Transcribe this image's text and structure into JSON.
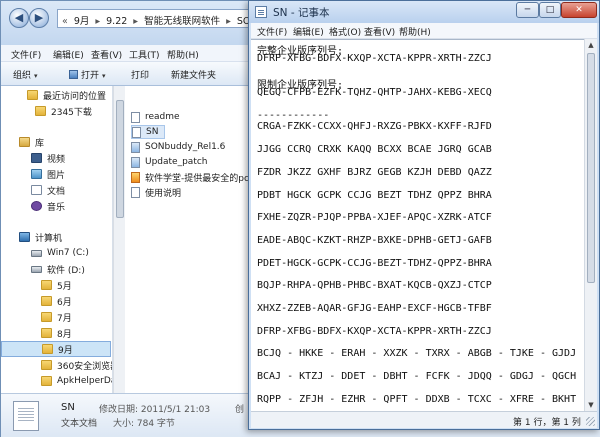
{
  "explorer": {
    "breadcrumb": [
      "«",
      "9月",
      "▸",
      "9.22",
      "▸",
      "智能无线联网软件",
      "▸",
      "SO"
    ],
    "menu": [
      "文件(F)",
      "编辑(E)",
      "查看(V)",
      "工具(T)",
      "帮助(H)"
    ],
    "toolbar": {
      "organize": "组织",
      "open": "打开",
      "print": "打印",
      "new_folder": "新建文件夹"
    },
    "nav_items": [
      {
        "label": "最近访问的位置",
        "icon": "recent-places-icon",
        "kind": "folder"
      },
      {
        "label": "2345下载",
        "icon": "folder-icon",
        "kind": "folder"
      },
      {
        "label": "库",
        "icon": "library-icon",
        "kind": "lib"
      },
      {
        "label": "视频",
        "icon": "video-icon",
        "kind": "video"
      },
      {
        "label": "图片",
        "icon": "picture-icon",
        "kind": "img"
      },
      {
        "label": "文档",
        "icon": "document-icon",
        "kind": "doc"
      },
      {
        "label": "音乐",
        "icon": "music-icon",
        "kind": "music"
      },
      {
        "label": "计算机",
        "icon": "computer-icon",
        "kind": "pc"
      },
      {
        "label": "Win7 (C:)",
        "icon": "drive-icon",
        "kind": "drive"
      },
      {
        "label": "软件 (D:)",
        "icon": "drive-icon",
        "kind": "drive"
      },
      {
        "label": "5月",
        "icon": "folder-icon",
        "kind": "folder"
      },
      {
        "label": "6月",
        "icon": "folder-icon",
        "kind": "folder"
      },
      {
        "label": "7月",
        "icon": "folder-icon",
        "kind": "folder"
      },
      {
        "label": "8月",
        "icon": "folder-icon",
        "kind": "folder"
      },
      {
        "label": "9月",
        "icon": "folder-icon",
        "kind": "folder",
        "selected": true
      },
      {
        "label": "360安全浏览器",
        "icon": "folder-icon",
        "kind": "folder"
      },
      {
        "label": "ApkHelperDa",
        "icon": "folder-icon",
        "kind": "folder"
      }
    ],
    "files": [
      {
        "name": "readme",
        "kind": "txt"
      },
      {
        "name": "SN",
        "kind": "txt",
        "selected": true
      },
      {
        "name": "SONbuddy_Rel1.6",
        "kind": "exe"
      },
      {
        "name": "Update_patch",
        "kind": "exe"
      },
      {
        "name": "软件学堂-提供最安全的pc软",
        "kind": "app"
      },
      {
        "name": "使用说明",
        "kind": "txt"
      }
    ],
    "details": {
      "name": "SN",
      "type": "文本文档",
      "modified": "修改日期: 2011/5/1 21:03",
      "size": "大小: 784 字节",
      "truncated": "创"
    }
  },
  "notepad": {
    "title": "SN - 记事本",
    "window_buttons": {
      "minimize": "─",
      "maximize": "□",
      "close": "✕"
    },
    "menu": [
      "文件(F)",
      "编辑(E)",
      "格式(O)",
      "查看(V)",
      "帮助(H)"
    ],
    "lines": [
      "完整企业版序列号:",
      "DFRP-XFBG-BDFX-KXQP-XCTA-KPPR-XRTH-ZZCJ",
      "",
      "限制企业版序列号:",
      "QEGQ-CFPB-EZFK-TQHZ-QHTP-JAHX-KEBG-XECQ",
      "",
      "------------",
      "CRGA-FZKK-CCXX-QHFJ-RXZG-PBKX-KXFF-RJFD",
      "",
      "JJGG CCRQ CRXK KAQQ BCXX BCAE JGRQ GCAB",
      "",
      "FZDR JKZZ GXHF BJRZ GEGB KZJH DEBD QAZZ",
      "",
      "PDBT HGCK GCPK CCJG BEZT TDHZ QPPZ BHRA",
      "",
      "FXHE-ZQZR-PJQP-PPBA-XJEF-APQC-XZRK-ATCF",
      "",
      "EADE-ABQC-KZKT-RHZP-BXKE-DPHB-GETJ-GAFB",
      "",
      "PDET-HGCK-GCPK-CCJG-BEZT-TDHZ-QPPZ-BHRA",
      "",
      "BQJP-RHPA-QPHB-PHBC-BXAT-KQCB-QXZJ-CTCP",
      "",
      "XHXZ-ZZEB-AQAR-GFJG-EAHP-EXCF-HGCB-TFBF",
      "",
      "DFRP-XFBG-BDFX-KXQP-XCTA-KPPR-XRTH-ZZCJ",
      "",
      "BCJQ - HKKE - ERAH - XXZK - TXRX - ABGB - TJKE - GJDJ",
      "",
      "BCAJ - KTZJ - DDET - DBHT - FCFK - JDQQ - GDGJ - QGCH",
      "",
      "RQPP - ZFJH - EZHR - QPFT - DDXB - TCXC - XFRE - BKHT"
    ],
    "status": "第 1 行，第 1 列"
  }
}
